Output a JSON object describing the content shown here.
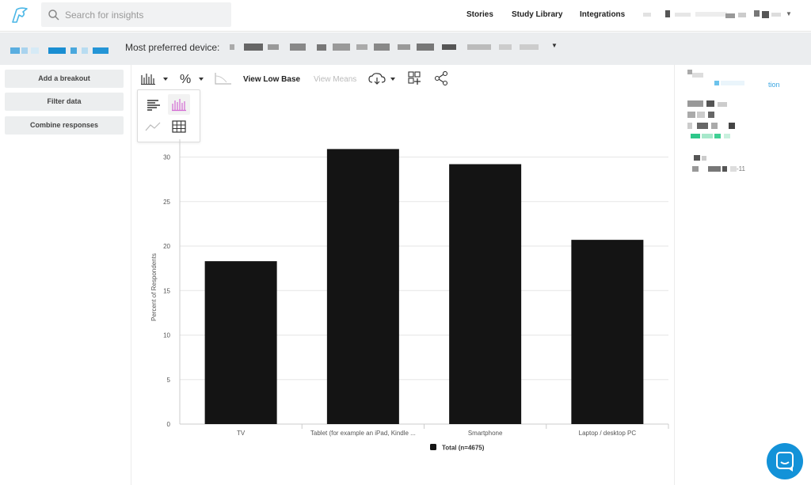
{
  "topnav": {
    "logo_icon": "bird-logo-icon",
    "search_placeholder": "Search for insights",
    "links": [
      "Stories",
      "Study Library",
      "Integrations"
    ],
    "user_menu_icon": "caret-down-icon"
  },
  "question": {
    "text": "Most preferred device:"
  },
  "sidebar": {
    "buttons": [
      "Add a breakout",
      "Filter data",
      "Combine responses"
    ]
  },
  "toolbar": {
    "view_low_base": "View Low Base",
    "view_means": "View Means",
    "icons": [
      "bar-chart-icon",
      "percent-icon",
      "axis-icon",
      "download-cloud-icon",
      "add-widget-icon",
      "share-icon"
    ]
  },
  "chart_menu": {
    "options": [
      "horizontal-bar-icon",
      "vertical-bar-icon",
      "line-chart-icon",
      "table-icon"
    ],
    "selected": "vertical-bar-icon"
  },
  "right_panel": {
    "partial_text": "tion",
    "partial_number": "-11"
  },
  "chart_data": {
    "type": "bar",
    "categories": [
      "TV",
      "Tablet (for example an iPad, Kindle ...",
      "Smartphone",
      "Laptop / desktop PC"
    ],
    "series": [
      {
        "name": "Total (n=4675)",
        "values": [
          18.3,
          30.9,
          29.2,
          20.7
        ],
        "color": "#141414"
      }
    ],
    "ylabel": "Percent of Respondents",
    "yticks": [
      0,
      5,
      10,
      15,
      20,
      25,
      30
    ],
    "ylim": [
      0,
      32
    ],
    "grid": true,
    "legend": "bottom"
  },
  "colors": {
    "accent": "#1392d8",
    "chart_selected": "#d36ad3",
    "bar": "#141414"
  }
}
